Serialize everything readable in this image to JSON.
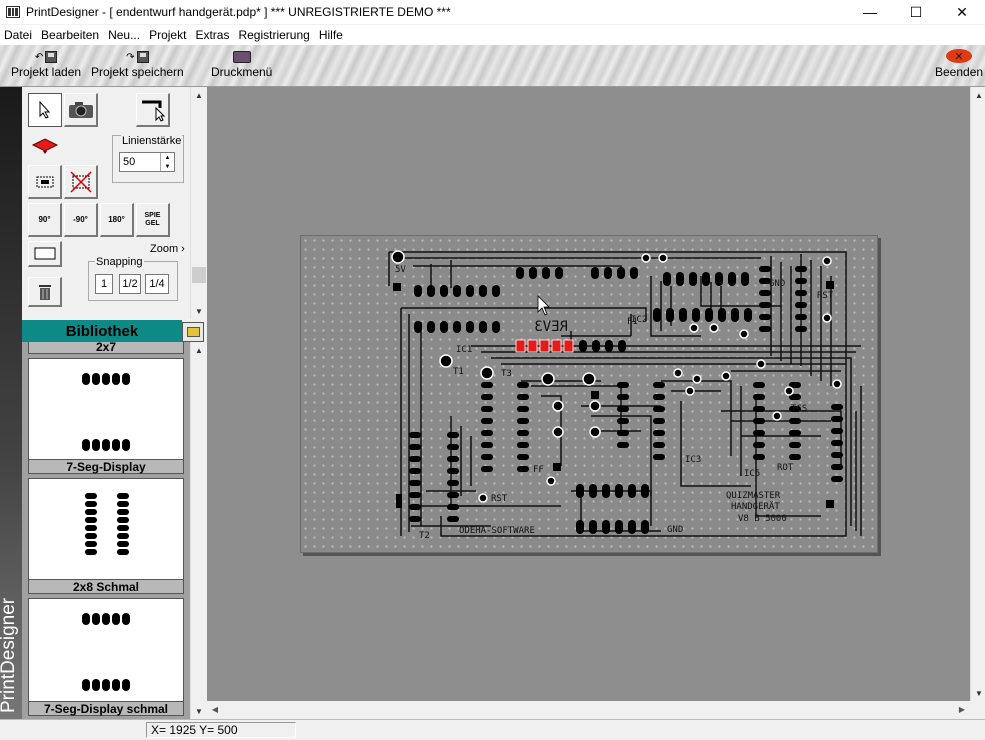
{
  "window": {
    "title": "PrintDesigner - [ endentwurf handgerät.pdp*  ] *** UNREGISTRIERTE DEMO ***",
    "minimize": "—",
    "maximize": "☐",
    "close": "✕"
  },
  "menu": [
    "Datei",
    "Bearbeiten",
    "Neu...",
    "Projekt",
    "Extras",
    "Registrierung",
    "Hilfe"
  ],
  "toolbar": {
    "load": "Projekt laden",
    "save": "Projekt speichern",
    "print": "Druckmenü",
    "exit": "Beenden"
  },
  "brand": "PrintDesigner",
  "tools": {
    "linien_label": "Linienstärke",
    "linien_value": "50",
    "zoom": "Zoom",
    "snapping_label": "Snapping",
    "snap_options": [
      "1",
      "1/2",
      "1/4"
    ],
    "rot90": "90°",
    "rotm90": "-90°",
    "rot180": "180°",
    "mirror": "SPIE GEL"
  },
  "library": {
    "header": "Bibliothek",
    "partial_item": "2x7",
    "items": [
      "7-Seg-Display",
      "2x8 Schmal",
      "7-Seg-Display schmal"
    ]
  },
  "board_text": {
    "rev": "REV3",
    "quiz": [
      "QUIZMASTER",
      "HANDGERÄT",
      "V8 B 5000"
    ],
    "software": "ODEHA-SOFTWARE",
    "labels": [
      "5V",
      "GND",
      "T1",
      "T2",
      "T3",
      "IC2",
      "IC1",
      "RST",
      "RST",
      "ROT",
      "IC3",
      "GND",
      "IC5",
      "TCS",
      "FF",
      "F1"
    ]
  },
  "status": {
    "coords": "X= 1925  Y= 500"
  },
  "colors": {
    "accent_teal": "#0e8a86",
    "board_bg": "#8a8a8a",
    "trace": "#111111",
    "highlight_red": "#e21b1b"
  }
}
